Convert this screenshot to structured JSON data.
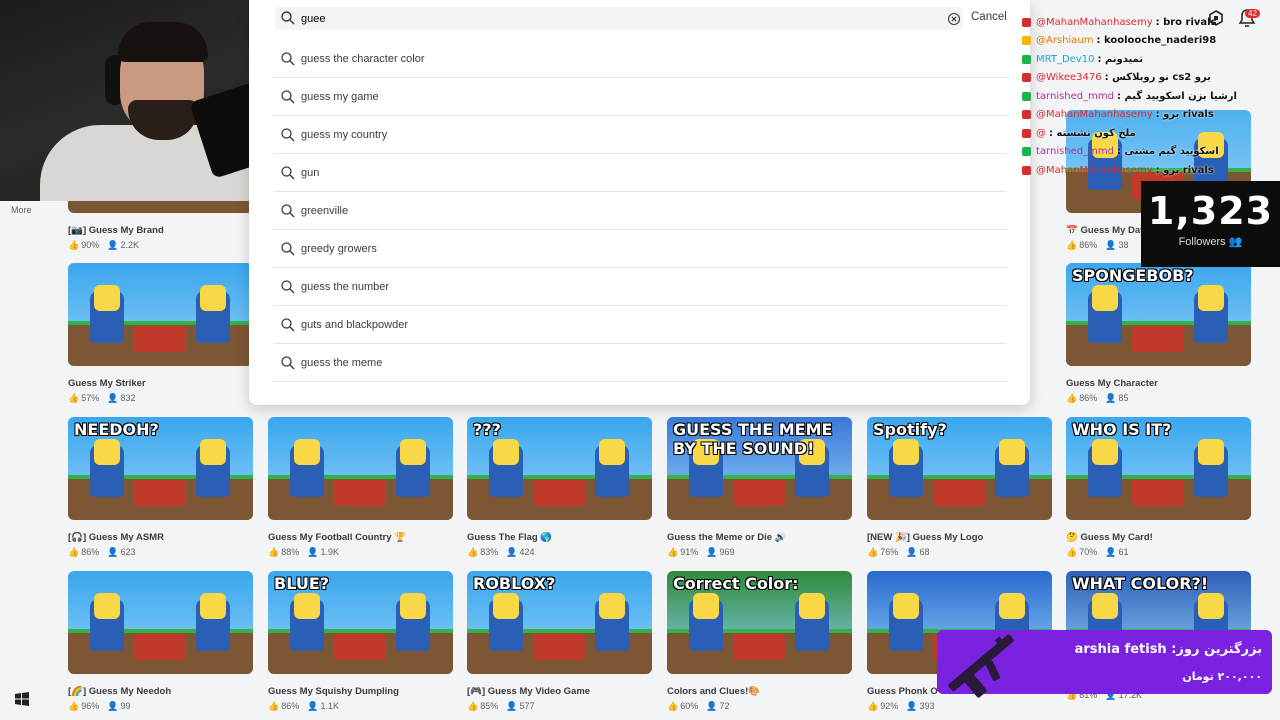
{
  "nav": {
    "more_label": "More"
  },
  "search": {
    "value": "guee",
    "cancel_label": "Cancel",
    "suggestions": [
      "guess the character color",
      "guess my game",
      "guess my country",
      "gun",
      "greenville",
      "greedy growers",
      "guess the number",
      "guts and blackpowder",
      "guess the meme"
    ]
  },
  "games": [
    {
      "title": "[📷] Guess My Brand",
      "rating": "90%",
      "players": "2.2K"
    },
    {
      "title": "📅 Guess My Dat",
      "rating": "86%",
      "players": "38"
    },
    {
      "title": "Guess My Striker",
      "rating": "57%",
      "players": "832",
      "overlay": ""
    },
    {
      "title": "Guess My Character",
      "rating": "86%",
      "players": "85",
      "overlay": "SPONGEBOB?"
    },
    {
      "title": "[🎧] Guess My ASMR",
      "rating": "86%",
      "players": "623",
      "overlay": "NEEDOH?"
    },
    {
      "title": "Guess My Football Country 🏆",
      "rating": "88%",
      "players": "1.9K",
      "overlay": ""
    },
    {
      "title": "Guess The Flag 🌎",
      "rating": "83%",
      "players": "424",
      "overlay": "???"
    },
    {
      "title": "Guess the Meme or Die 🔊",
      "rating": "91%",
      "players": "969",
      "overlay": "GUESS THE MEME BY THE SOUND!"
    },
    {
      "title": "[NEW 🎉] Guess My Logo",
      "rating": "76%",
      "players": "68",
      "overlay": "Spotify?"
    },
    {
      "title": "🤔 Guess My Card!",
      "rating": "70%",
      "players": "61",
      "overlay": "WHO IS IT?"
    },
    {
      "title": "[🌈] Guess My Needoh",
      "rating": "96%",
      "players": "99",
      "overlay": ""
    },
    {
      "title": "Guess My Squishy Dumpling",
      "rating": "86%",
      "players": "1.1K",
      "overlay": "BLUE?"
    },
    {
      "title": "[🎮] Guess My Video Game",
      "rating": "85%",
      "players": "577",
      "overlay": "ROBLOX?"
    },
    {
      "title": "Colors and Clues!🎨",
      "rating": "60%",
      "players": "72",
      "overlay": "Correct Color:"
    },
    {
      "title": "Guess Phonk O",
      "rating": "92%",
      "players": "393",
      "overlay": ""
    },
    {
      "title": "",
      "rating": "61%",
      "players": "17.2K",
      "overlay": "WHAT COLOR?!"
    }
  ],
  "chat": [
    {
      "user": "@MahanMahanhasemy",
      "msg": ": bro rivals",
      "color": "#e0282e",
      "badge": "#d32f2f"
    },
    {
      "user": "@Arshiaum",
      "msg": ": koolooche_naderi98",
      "color": "#e07b00",
      "badge": "#f5b400"
    },
    {
      "user": "MRT_Dev10",
      "msg": ": تمیدونم",
      "color": "#1aa3d8",
      "badge": "#19b44b"
    },
    {
      "user": "@Wikee3476",
      "msg": ": نو روبلاکس cs2 برو",
      "color": "#e0282e",
      "badge": "#d32f2f"
    },
    {
      "user": "tarnished_mmd",
      "msg": ": ارشیا بزن اسکویید گیم",
      "color": "#b4309c",
      "badge": "#19b44b"
    },
    {
      "user": "@MahanMahanhasemy",
      "msg": ": برو rivals",
      "color": "#e0282e",
      "badge": "#d32f2f"
    },
    {
      "user": "@",
      "msg": ": ملخ کون نشسته",
      "color": "#e0282e",
      "badge": "#d32f2f"
    },
    {
      "user": "tarnished_mmd",
      "msg": ": اسکویید گیم مشتی",
      "color": "#b4309c",
      "badge": "#19b44b"
    },
    {
      "user": "@MahanMahanhasemy",
      "msg": ": برو rivals",
      "color": "#e0282e",
      "badge": "#d32f2f"
    }
  ],
  "notifications": {
    "count": "42"
  },
  "followers": {
    "count": "1,323",
    "label": "Followers"
  },
  "donation": {
    "title": "بزرگترین روز: arshia fetish",
    "amount": "۲۰۰,۰۰۰ تومان"
  }
}
